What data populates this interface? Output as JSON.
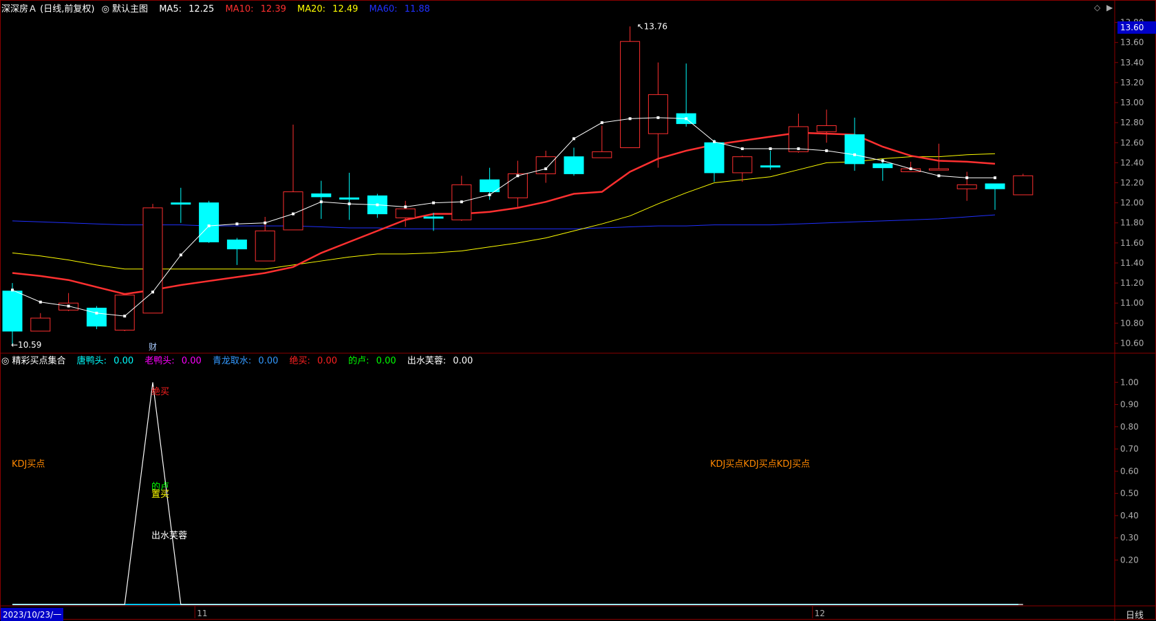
{
  "header": {
    "title": "深深房Ａ (日线,前复权)",
    "main_chart_label": "默认主图",
    "ma5": {
      "label": "MA5:",
      "value": "12.25",
      "color": "#ffffff"
    },
    "ma10": {
      "label": "MA10:",
      "value": "12.39",
      "color": "#ff3030"
    },
    "ma20": {
      "label": "MA20:",
      "value": "12.49",
      "color": "#ffff00"
    },
    "ma60": {
      "label": "MA60:",
      "value": "11.88",
      "color": "#2030ff"
    }
  },
  "indicator_header": {
    "title": "精彩买点集合",
    "items": [
      {
        "label": "唐鸭头:",
        "value": "0.00",
        "color": "#00ffff"
      },
      {
        "label": "老鸭头:",
        "value": "0.00",
        "color": "#ff00ff"
      },
      {
        "label": "青龙取水:",
        "value": "0.00",
        "color": "#3399ff"
      },
      {
        "label": "绝买:",
        "value": "0.00",
        "color": "#ff2020"
      },
      {
        "label": "的卢:",
        "value": "0.00",
        "color": "#00ff00"
      },
      {
        "label": "出水芙蓉:",
        "value": "0.00",
        "color": "#ffffff"
      }
    ]
  },
  "current_price": "13.60",
  "start_date": "2023/10/23/一",
  "period_label": "日线",
  "month_labels": [
    "11",
    "12"
  ],
  "markers": {
    "high": "13.76",
    "low": "10.59",
    "cai": "财"
  },
  "indicator_texts": {
    "kdj_left": "KDJ买点",
    "kdj_right": "KDJ买点KDJ买点KDJ买点",
    "juemai": "绝买",
    "dilu": "的卢",
    "zhimai": "置买",
    "chushui": "出水芙蓉"
  },
  "y_axis_top": [
    "13.80",
    "13.60",
    "13.40",
    "13.20",
    "13.00",
    "12.80",
    "12.60",
    "12.40",
    "12.20",
    "12.00",
    "11.80",
    "11.60",
    "11.40",
    "11.20",
    "11.00",
    "10.80",
    "10.60"
  ],
  "y_axis_bottom": [
    "1.00",
    "0.90",
    "0.80",
    "0.70",
    "0.60",
    "0.50",
    "0.40",
    "0.30",
    "0.20"
  ],
  "chart_data": {
    "type": "candlestick",
    "candles": [
      {
        "o": 11.12,
        "c": 10.72,
        "h": 11.2,
        "l": 10.59
      },
      {
        "o": 10.72,
        "c": 10.85,
        "h": 10.9,
        "l": 10.72
      },
      {
        "o": 10.93,
        "c": 11.0,
        "h": 11.1,
        "l": 10.92
      },
      {
        "o": 10.95,
        "c": 10.77,
        "h": 10.97,
        "l": 10.74
      },
      {
        "o": 10.73,
        "c": 11.08,
        "h": 11.1,
        "l": 10.72
      },
      {
        "o": 10.9,
        "c": 11.95,
        "h": 11.99,
        "l": 10.9
      },
      {
        "o": 12.0,
        "c": 11.99,
        "h": 12.15,
        "l": 11.8
      },
      {
        "o": 12.0,
        "c": 11.61,
        "h": 12.02,
        "l": 11.6
      },
      {
        "o": 11.63,
        "c": 11.54,
        "h": 11.65,
        "l": 11.38
      },
      {
        "o": 11.42,
        "c": 11.72,
        "h": 11.86,
        "l": 11.42
      },
      {
        "o": 11.73,
        "c": 12.11,
        "h": 12.78,
        "l": 11.73
      },
      {
        "o": 12.09,
        "c": 12.06,
        "h": 12.22,
        "l": 11.84
      },
      {
        "o": 12.05,
        "c": 12.04,
        "h": 12.3,
        "l": 11.83
      },
      {
        "o": 12.07,
        "c": 11.89,
        "h": 12.09,
        "l": 11.85
      },
      {
        "o": 11.85,
        "c": 11.94,
        "h": 12.02,
        "l": 11.76
      },
      {
        "o": 11.86,
        "c": 11.85,
        "h": 11.9,
        "l": 11.72
      },
      {
        "o": 11.83,
        "c": 12.18,
        "h": 12.27,
        "l": 11.82
      },
      {
        "o": 12.23,
        "c": 12.11,
        "h": 12.35,
        "l": 12.03
      },
      {
        "o": 12.05,
        "c": 12.29,
        "h": 12.42,
        "l": 11.96
      },
      {
        "o": 12.29,
        "c": 12.46,
        "h": 12.52,
        "l": 12.2
      },
      {
        "o": 12.46,
        "c": 12.29,
        "h": 12.55,
        "l": 12.27
      },
      {
        "o": 12.45,
        "c": 12.51,
        "h": 12.77,
        "l": 12.45
      },
      {
        "o": 12.55,
        "c": 13.61,
        "h": 13.76,
        "l": 12.55
      },
      {
        "o": 12.69,
        "c": 13.08,
        "h": 13.4,
        "l": 12.35
      },
      {
        "o": 12.89,
        "c": 12.79,
        "h": 13.39,
        "l": 12.76
      },
      {
        "o": 12.6,
        "c": 12.3,
        "h": 12.63,
        "l": 12.21
      },
      {
        "o": 12.3,
        "c": 12.46,
        "h": 12.47,
        "l": 12.21
      },
      {
        "o": 12.37,
        "c": 12.36,
        "h": 12.52,
        "l": 12.33
      },
      {
        "o": 12.51,
        "c": 12.76,
        "h": 12.89,
        "l": 12.5
      },
      {
        "o": 12.71,
        "c": 12.77,
        "h": 12.93,
        "l": 12.6
      },
      {
        "o": 12.68,
        "c": 12.39,
        "h": 12.85,
        "l": 12.32
      },
      {
        "o": 12.39,
        "c": 12.35,
        "h": 12.44,
        "l": 12.22
      },
      {
        "o": 12.31,
        "c": 12.34,
        "h": 12.41,
        "l": 12.31
      },
      {
        "o": 12.33,
        "c": 12.34,
        "h": 12.59,
        "l": 12.33
      },
      {
        "o": 12.14,
        "c": 12.18,
        "h": 12.31,
        "l": 12.02
      },
      {
        "o": 12.19,
        "c": 12.14,
        "h": 12.19,
        "l": 11.93
      },
      {
        "o": 12.08,
        "c": 12.27,
        "h": 12.29,
        "l": 12.08
      }
    ],
    "ma5": [
      11.13,
      11.01,
      10.97,
      10.9,
      10.87,
      11.11,
      11.48,
      11.77,
      11.79,
      11.8,
      11.89,
      12.01,
      11.99,
      11.98,
      11.96,
      12.0,
      12.01,
      12.08,
      12.27,
      12.34,
      12.64,
      12.8,
      12.84,
      12.85,
      12.84,
      12.61,
      12.54,
      12.54,
      12.54,
      12.52,
      12.48,
      12.42,
      12.34,
      12.27,
      12.25,
      12.25
    ],
    "ma10": [
      11.3,
      11.27,
      11.23,
      11.16,
      11.09,
      11.13,
      11.18,
      11.22,
      11.26,
      11.3,
      11.36,
      11.5,
      11.61,
      11.72,
      11.83,
      11.89,
      11.89,
      11.91,
      11.95,
      12.01,
      12.09,
      12.11,
      12.31,
      12.44,
      12.52,
      12.58,
      12.62,
      12.66,
      12.7,
      12.69,
      12.68,
      12.56,
      12.47,
      12.42,
      12.41,
      12.39
    ],
    "ma20": [
      11.5,
      11.47,
      11.43,
      11.38,
      11.34,
      11.34,
      11.34,
      11.34,
      11.34,
      11.34,
      11.38,
      11.42,
      11.46,
      11.49,
      11.49,
      11.5,
      11.52,
      11.56,
      11.6,
      11.65,
      11.72,
      11.79,
      11.87,
      11.99,
      12.1,
      12.2,
      12.23,
      12.26,
      12.33,
      12.4,
      12.41,
      12.44,
      12.46,
      12.46,
      12.48,
      12.49
    ],
    "ma60": [
      11.82,
      11.81,
      11.8,
      11.79,
      11.78,
      11.78,
      11.78,
      11.77,
      11.77,
      11.77,
      11.77,
      11.76,
      11.75,
      11.75,
      11.74,
      11.74,
      11.74,
      11.74,
      11.74,
      11.74,
      11.74,
      11.75,
      11.76,
      11.77,
      11.77,
      11.78,
      11.78,
      11.78,
      11.79,
      11.8,
      11.81,
      11.82,
      11.83,
      11.84,
      11.86,
      11.88
    ],
    "signal": [
      0,
      0,
      0,
      0,
      0,
      1,
      0,
      0,
      0,
      0,
      0,
      0,
      0,
      0,
      0,
      0,
      0,
      0,
      0,
      0,
      0,
      0,
      0,
      0,
      0,
      0,
      0,
      0,
      0,
      0,
      0,
      0,
      0,
      0,
      0,
      0,
      0
    ],
    "price_range": [
      10.5,
      13.9
    ],
    "indicator_range": [
      0,
      1.1
    ]
  },
  "colors": {
    "up": "#ff3030",
    "down": "#00ffff",
    "grid": "#8b0000",
    "axis_text": "#b0b0b0",
    "signal_line": "#ffffff",
    "baseline": "#00c8ff",
    "kdj_text": "#ff8800"
  }
}
